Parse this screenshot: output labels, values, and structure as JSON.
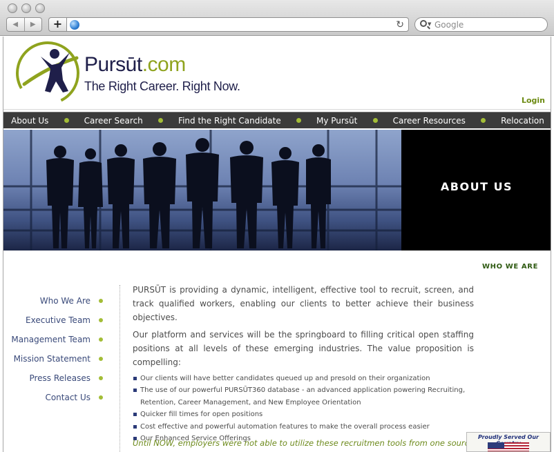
{
  "browser": {
    "url": "",
    "search_placeholder": "Google",
    "back_glyph": "◀",
    "forward_glyph": "▶",
    "add_glyph": "+",
    "reload_glyph": "↻"
  },
  "header": {
    "brand_main": "Pursūt",
    "brand_suffix": ".com",
    "tagline": "The Right Career. Right Now.",
    "login": "Login"
  },
  "mainnav": [
    "About Us",
    "Career Search",
    "Find the Right Candidate",
    "My Pursūt",
    "Career Resources",
    "Relocation"
  ],
  "hero": {
    "title": "ABOUT US"
  },
  "section_label": "WHO WE ARE",
  "sidenav": [
    "Who We Are",
    "Executive Team",
    "Management Team",
    "Mission Statement",
    "Press Releases",
    "Contact Us"
  ],
  "content": {
    "paragraphs": [
      "PURSŪT is providing a dynamic, intelligent, effective tool to recruit, screen, and track qualified workers, enabling our clients to better achieve their business objectives.",
      "Our platform and services will be the springboard to filling critical open staffing positions at all levels of these emerging industries. The value proposition is compelling:"
    ],
    "bullets": [
      "Our clients will have better candidates queued up and presold on their organization",
      "The use of our powerful PURSŪT360 database - an advanced application powering Recruiting, Retention, Career Management, and New Employee Orientation",
      "Quicker fill times for open positions",
      "Cost effective and powerful automation features to make the overall process easier",
      "Our Enhanced Service Offerings"
    ],
    "closing": "Until NOW, employers were not able to utilize these recruitmen tools from one source."
  },
  "badge": {
    "text": "Proudly Served Our Country"
  },
  "colors": {
    "accent_green": "#a3bd37",
    "nav_bg": "#3b3b3b",
    "brand_navy": "#1f1f4a",
    "label_green": "#2f5a12"
  }
}
